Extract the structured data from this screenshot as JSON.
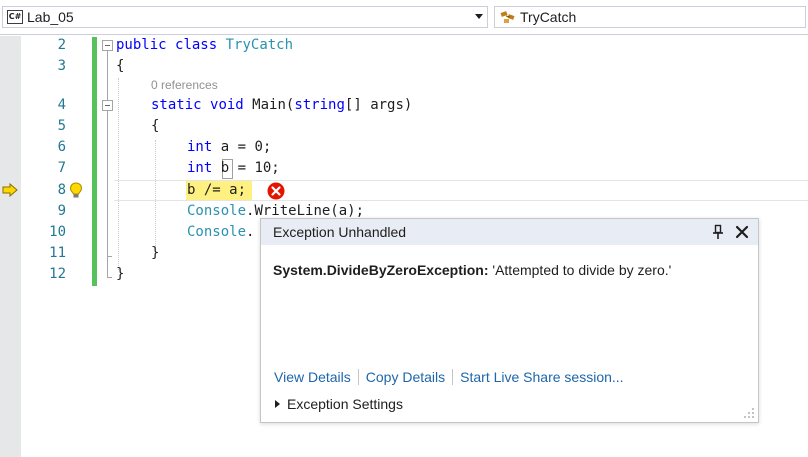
{
  "navbar": {
    "project_combo": {
      "icon_text": "C#",
      "value": "Lab_05"
    },
    "member_combo": {
      "value": "TryCatch"
    }
  },
  "editor": {
    "line_numbers": [
      "2",
      "3",
      "4",
      "5",
      "6",
      "7",
      "8",
      "9",
      "10",
      "11",
      "12"
    ],
    "codelens": "0 references",
    "code": {
      "l2": {
        "kw1": "public",
        "kw2": "class",
        "type": "TryCatch"
      },
      "l3": "{",
      "l4": {
        "kw1": "static",
        "kw2": "void",
        "name": "Main(",
        "kw3": "string",
        "rest": "[] args)"
      },
      "l5": "{",
      "l6": {
        "kw": "int",
        "rest": " a = 0;"
      },
      "l7": {
        "kw": "int",
        "rest": " b = 10;"
      },
      "l8": "b /= a;",
      "l9": {
        "type": "Console",
        "rest": ".WriteLine(a);"
      },
      "l10": {
        "type": "Console",
        "rest": "."
      },
      "l11": "}",
      "l12": "}"
    }
  },
  "exception_popup": {
    "title": "Exception Unhandled",
    "exception_type": "System.DivideByZeroException:",
    "exception_message": " 'Attempted to divide by zero.'",
    "links": [
      "View Details",
      "Copy Details",
      "Start Live Share session..."
    ],
    "settings_label": "Exception Settings"
  },
  "colors": {
    "keyword": "#0000ff",
    "type": "#2b91af",
    "line_number": "#237893",
    "link": "#1e66aa",
    "statement_highlight": "#fff181",
    "change_bar": "#57c25c",
    "error": "#e51400"
  },
  "icons": {
    "execution_pointer": "yellow-arrow-icon",
    "lightbulb": "lightbulb-icon",
    "error": "error-x-icon",
    "pin": "pin-icon",
    "close": "close-icon",
    "class": "class-icon"
  }
}
